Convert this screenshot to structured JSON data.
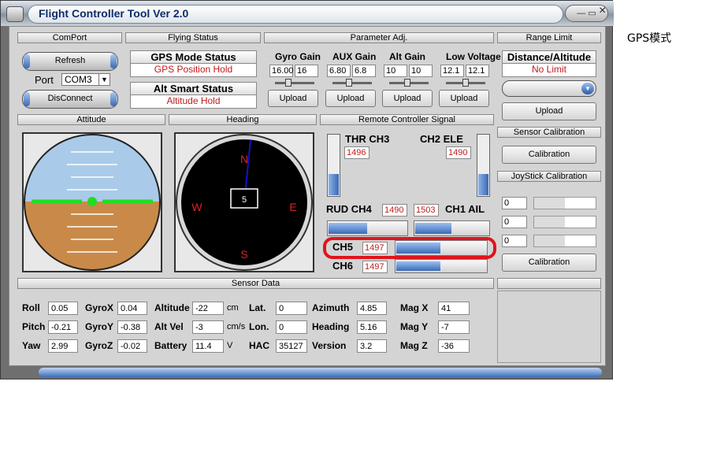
{
  "window": {
    "title": "Flight Controller Tool  Ver 2.0",
    "controls": "— ▭"
  },
  "side_label": "GPS模式",
  "sections": {
    "comport": "ComPort",
    "flying_status": "Flying Status",
    "param_adj": "Parameter Adj.",
    "range_limit": "Range Limit",
    "attitude": "Attitude",
    "heading": "Heading",
    "rc_signal": "Remote Controller Signal",
    "sensor_calib": "Sensor Calibration",
    "joystick_calib": "JoyStick Calibration",
    "sensor_data": "Sensor Data"
  },
  "comport": {
    "refresh": "Refresh",
    "port_label": "Port",
    "port_value": "COM3",
    "disconnect": "DisConnect"
  },
  "flying_status": {
    "gps_title": "GPS Mode Status",
    "gps_value": "GPS Position Hold",
    "alt_title": "Alt Smart Status",
    "alt_value": "Altitude Hold"
  },
  "params": [
    {
      "label": "Gyro Gain",
      "current": "16.00",
      "set": "16",
      "slider": 0.3,
      "upload": "Upload"
    },
    {
      "label": "AUX Gain",
      "current": "6.80",
      "set": "6.8",
      "slider": 0.4,
      "upload": "Upload"
    },
    {
      "label": "Alt Gain",
      "current": "10",
      "set": "10",
      "slider": 0.45,
      "upload": "Upload"
    },
    {
      "label": "Low Voltage",
      "current": "12.1",
      "set": "12.1",
      "slider": 0.5,
      "upload": "Upload"
    }
  ],
  "range_limit": {
    "title": "Distance/Altitude",
    "value": "No Limit",
    "upload": "Upload"
  },
  "sensor_calib": {
    "button": "Calibration"
  },
  "joystick": {
    "values": [
      "0",
      "0",
      "0"
    ],
    "button": "Calibration"
  },
  "heading": {
    "center": "5",
    "n": "N",
    "e": "E",
    "s": "S",
    "w": "W"
  },
  "rc": {
    "thr_label": "THR CH3",
    "thr_value": "1496",
    "thr_level": 0.35,
    "ele_label": "CH2 ELE",
    "ele_value": "1490",
    "ele_level": 0.35,
    "rud_label": "RUD CH4",
    "rud_value": "1490",
    "rud_level": 0.5,
    "ail_label": "CH1 AIL",
    "ail_value": "1503",
    "ail_level": 0.5,
    "ch5_label": "CH5",
    "ch5_value": "1497",
    "ch5_level": 0.5,
    "ch6_label": "CH6",
    "ch6_value": "1497",
    "ch6_level": 0.5
  },
  "sensor_data": {
    "roll": {
      "label": "Roll",
      "value": "0.05"
    },
    "pitch": {
      "label": "Pitch",
      "value": "-0.21"
    },
    "yaw": {
      "label": "Yaw",
      "value": "2.99"
    },
    "gyrox": {
      "label": "GyroX",
      "value": "0.04"
    },
    "gyroy": {
      "label": "GyroY",
      "value": "-0.38"
    },
    "gyroz": {
      "label": "GyroZ",
      "value": "-0.02"
    },
    "altitude": {
      "label": "Altitude",
      "value": "-22",
      "unit": "cm"
    },
    "altvel": {
      "label": "Alt Vel",
      "value": "-3",
      "unit": "cm/s"
    },
    "battery": {
      "label": "Battery",
      "value": "11.4",
      "unit": "V"
    },
    "lat": {
      "label": "Lat.",
      "value": "0"
    },
    "lon": {
      "label": "Lon.",
      "value": "0"
    },
    "hac": {
      "label": "HAC",
      "value": "35127"
    },
    "azimuth": {
      "label": "Azimuth",
      "value": "4.85"
    },
    "heading": {
      "label": "Heading",
      "value": "5.16"
    },
    "version": {
      "label": "Version",
      "value": "3.2"
    },
    "magx": {
      "label": "Mag X",
      "value": "41"
    },
    "magy": {
      "label": "Mag Y",
      "value": "-7"
    },
    "magz": {
      "label": "Mag Z",
      "value": "-36"
    }
  },
  "colors": {
    "highlight": "#e0141c",
    "bar": "#3868b5",
    "sky": "#a9cbe9",
    "ground": "#c98a49",
    "horizon": "#22dd22"
  }
}
